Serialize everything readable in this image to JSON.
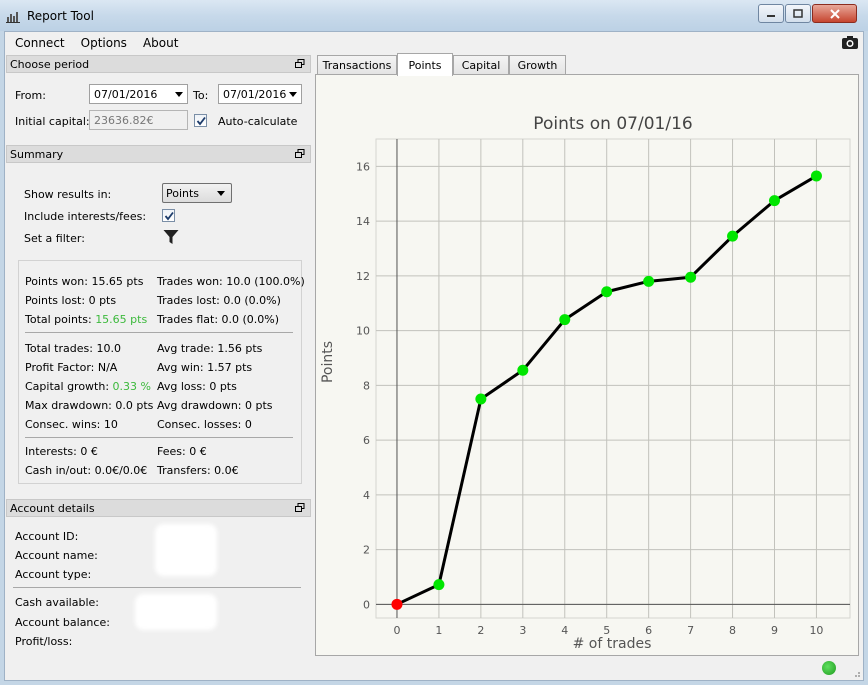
{
  "window": {
    "title": "Report Tool"
  },
  "menu": [
    "Connect",
    "Options",
    "About"
  ],
  "period": {
    "header": "Choose period",
    "from_label": "From:",
    "from_value": "07/01/2016",
    "to_label": "To:",
    "to_value": "07/01/2016",
    "initial_capital_label": "Initial capital:",
    "initial_capital_value": "23636.82€",
    "auto_calc_label": "Auto-calculate"
  },
  "summary": {
    "header": "Summary",
    "show_results_label": "Show results in:",
    "show_results_value": "Points",
    "include_interests_label": "Include interests/fees:",
    "filter_label": "Set a filter:",
    "stats": {
      "points_won": "Points won: 15.65 pts",
      "points_lost": "Points lost: 0 pts",
      "total_points_label": "Total points:",
      "total_points_value": "15.65 pts",
      "trades_won": "Trades won: 10.0 (100.0%)",
      "trades_lost": "Trades lost: 0.0 (0.0%)",
      "trades_flat": "Trades flat: 0.0 (0.0%)",
      "total_trades": "Total trades: 10.0",
      "profit_factor": "Profit Factor: N/A",
      "capital_growth_label": "Capital growth:",
      "capital_growth_value": "0.33 %",
      "max_drawdown": "Max drawdown: 0.0 pts",
      "consec_wins": "Consec. wins: 10",
      "avg_trade": "Avg trade: 1.56 pts",
      "avg_win": "Avg win: 1.57 pts",
      "avg_loss": "Avg loss: 0 pts",
      "avg_drawdown": "Avg drawdown: 0 pts",
      "consec_losses": "Consec. losses: 0",
      "interests": "Interests: 0 €",
      "cash_in_out": "Cash in/out: 0.0€/0.0€",
      "fees": "Fees: 0 €",
      "transfers": "Transfers: 0.0€"
    }
  },
  "account": {
    "header": "Account details",
    "id_label": "Account ID:",
    "name_label": "Account name:",
    "type_label": "Account type:",
    "cash_label": "Cash available:",
    "balance_label": "Account balance:",
    "pl_label": "Profit/loss:"
  },
  "tabs": [
    "Transactions",
    "Points",
    "Capital",
    "Growth"
  ],
  "active_tab": "Points",
  "colors": {
    "line": "#000000",
    "point": "#00e600",
    "first_point": "#ff0000",
    "accent_green": "#3cb93c"
  },
  "chart_data": {
    "type": "line",
    "title": "Points on 07/01/16",
    "xlabel": "# of trades",
    "ylabel": "Points",
    "x": [
      0,
      1,
      2,
      3,
      4,
      5,
      6,
      7,
      8,
      9,
      10
    ],
    "y": [
      0,
      0.72,
      7.5,
      8.55,
      10.4,
      11.42,
      11.8,
      11.95,
      13.45,
      14.75,
      15.65
    ],
    "xlim": [
      -0.5,
      10.8
    ],
    "ylim": [
      -0.5,
      17
    ],
    "xticks": [
      0,
      1,
      2,
      3,
      4,
      5,
      6,
      7,
      8,
      9,
      10
    ],
    "yticks": [
      0,
      2,
      4,
      6,
      8,
      10,
      12,
      14,
      16
    ],
    "grid": true
  }
}
